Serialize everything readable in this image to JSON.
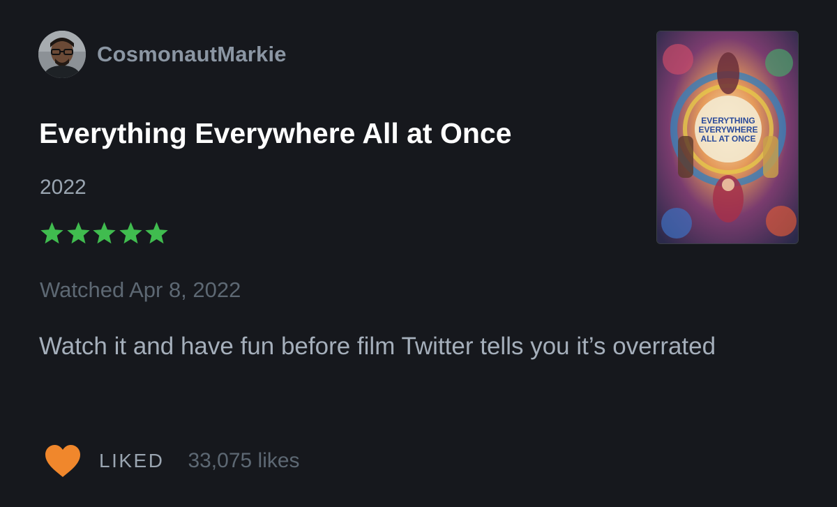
{
  "user": {
    "name": "CosmonautMarkie"
  },
  "film": {
    "title": "Everything Everywhere All at Once",
    "year": "2022",
    "rating_stars": 5,
    "rating_max": 5,
    "poster_title_lines": [
      "EVERYTHING",
      "EVERYWHERE",
      "ALL AT ONCE"
    ]
  },
  "review": {
    "watched": "Watched Apr 8, 2022",
    "text": "Watch it and have fun before film Twitter tells you it’s overrated"
  },
  "footer": {
    "liked_label": "LIKED",
    "likes_count": "33,075 likes"
  },
  "colors": {
    "background": "#16181d",
    "star": "#40bc4f",
    "heart": "#f0872c",
    "username": "#8b96a3"
  },
  "icons": {
    "star": "star-icon",
    "heart": "heart-icon"
  }
}
